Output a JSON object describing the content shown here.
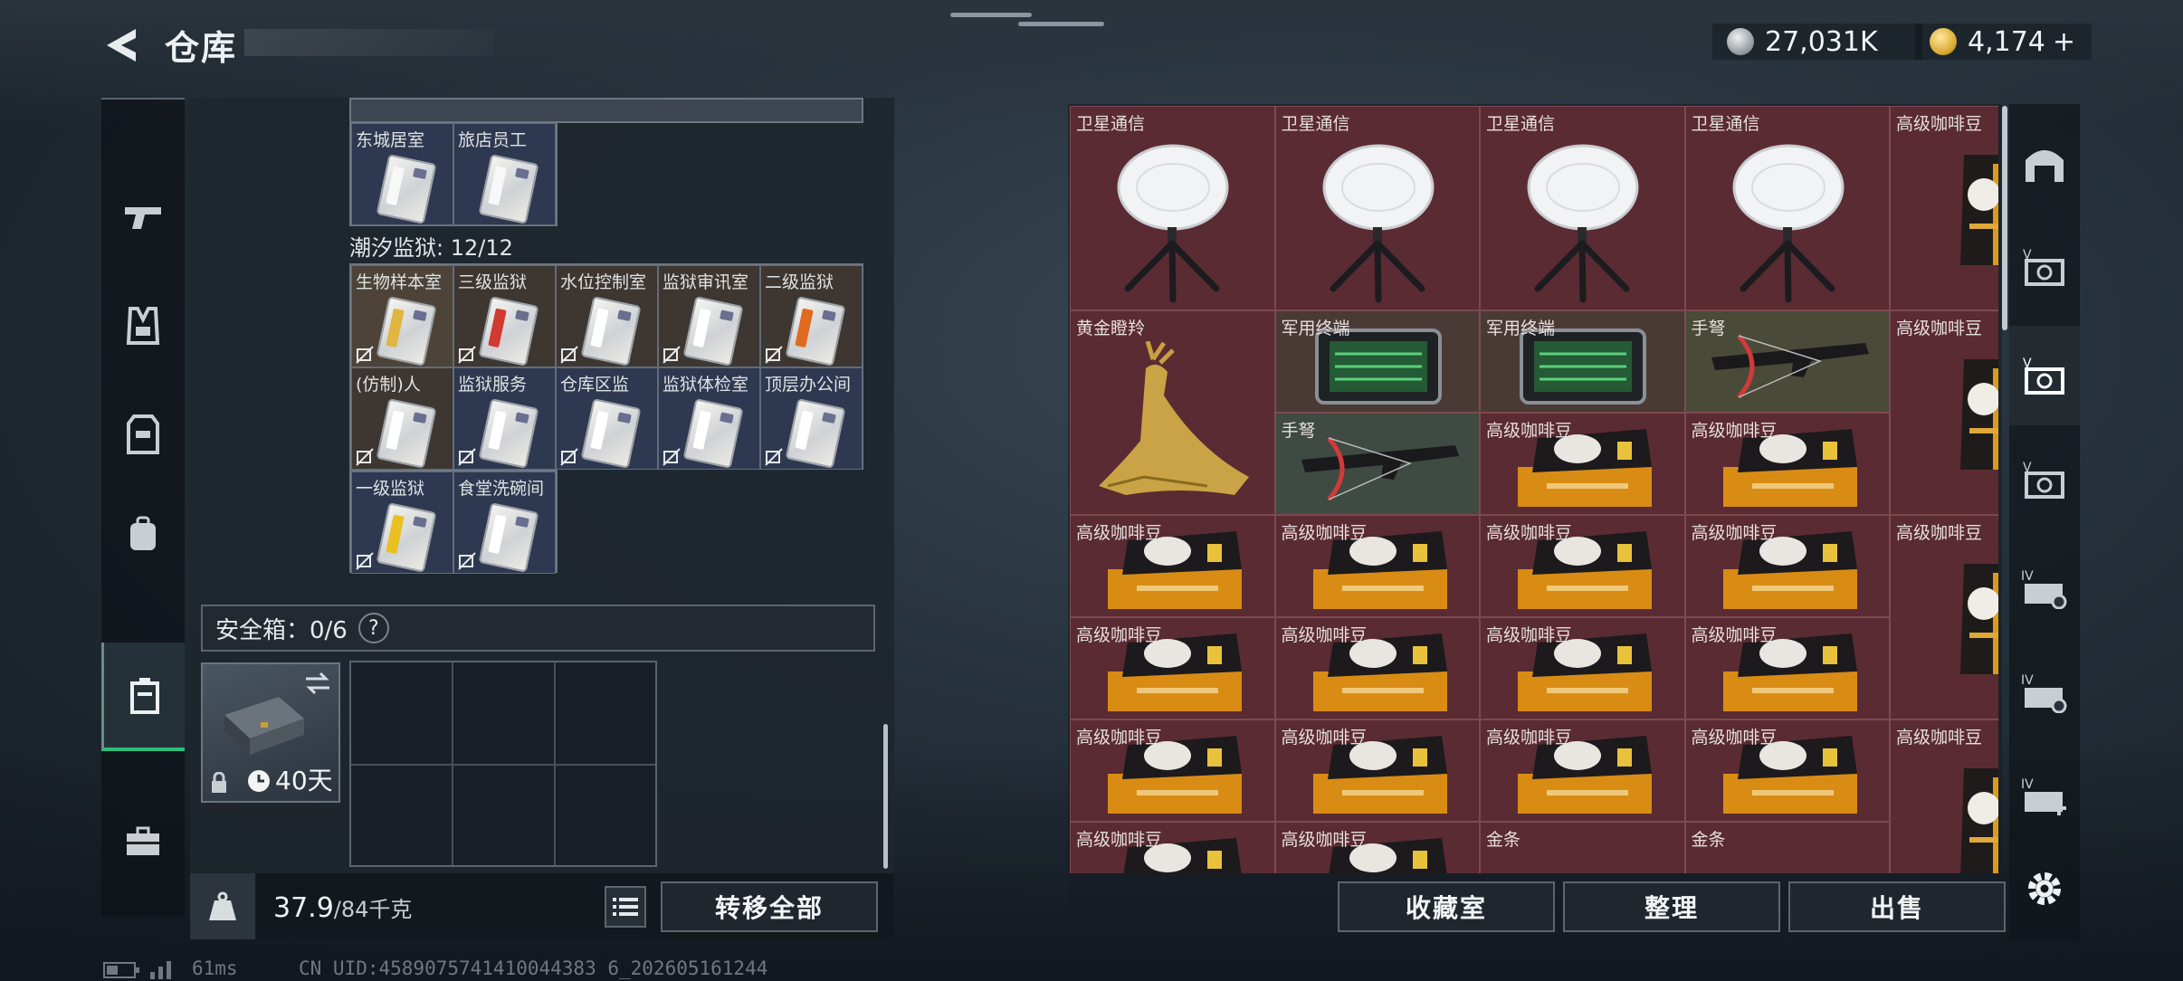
{
  "header": {
    "title": "仓库",
    "currency_silver": "27,031K",
    "currency_gold": "4,174",
    "currency_add": "+"
  },
  "colors": {
    "accent_green": "#27c07a",
    "item_red": "#5a2b32",
    "slot_gold": "#4e4338",
    "slot_blue": "#2e3850"
  },
  "left_nav": {
    "items": [
      {
        "icon": "pistol-icon"
      },
      {
        "icon": "vest-icon"
      },
      {
        "icon": "armor-icon"
      },
      {
        "icon": "backpack-icon"
      },
      {
        "icon": "safe-case-icon",
        "active": true
      },
      {
        "icon": "toolbox-icon"
      }
    ]
  },
  "left_panel": {
    "group_top": {
      "cells": [
        {
          "label": "东城居室",
          "stripe": "#ffffff"
        },
        {
          "label": "旅店员工",
          "stripe": "#ffffff"
        }
      ]
    },
    "prison": {
      "title": "潮汐监狱: 12/12",
      "cells": [
        {
          "label": "生物样本室",
          "stripe": "#e0b640",
          "bg": "gold"
        },
        {
          "label": "三级监狱",
          "stripe": "#d03a30",
          "bg": "dgold"
        },
        {
          "label": "水位控制室",
          "stripe": "#ffffff",
          "bg": "dgold"
        },
        {
          "label": "监狱审讯室",
          "stripe": "#ffffff",
          "bg": "dgold"
        },
        {
          "label": "二级监狱",
          "stripe": "#e06a20",
          "bg": "dgold"
        },
        {
          "label": "(仿制)人",
          "stripe": "#ffffff",
          "bg": "dgold"
        },
        {
          "label": "监狱服务",
          "stripe": "#ffffff",
          "bg": "blue"
        },
        {
          "label": "仓库区监",
          "stripe": "#ffffff",
          "bg": "blue"
        },
        {
          "label": "监狱体检室",
          "stripe": "#ffffff",
          "bg": "blue"
        },
        {
          "label": "顶层办公间",
          "stripe": "#ffffff",
          "bg": "blue"
        },
        {
          "label": "一级监狱",
          "stripe": "#e8c020",
          "bg": "blue"
        },
        {
          "label": "食堂洗碗间",
          "stripe": "#ffffff",
          "bg": "blue"
        }
      ]
    },
    "safe_box": {
      "label": "安全箱：0/6",
      "help": "?",
      "duration": "40天"
    },
    "weight": {
      "current": "37.9",
      "max": "/84千克"
    },
    "transfer_all": "转移全部"
  },
  "right_panel": {
    "items": [
      {
        "label": "卫星通信",
        "art": "dish",
        "col": 0,
        "row": 0,
        "w": 1,
        "h": 2
      },
      {
        "label": "卫星通信",
        "art": "dish",
        "col": 1,
        "row": 0,
        "w": 1,
        "h": 2
      },
      {
        "label": "卫星通信",
        "art": "dish",
        "col": 2,
        "row": 0,
        "w": 1,
        "h": 2
      },
      {
        "label": "卫星通信",
        "art": "dish",
        "col": 3,
        "row": 0,
        "w": 1,
        "h": 2
      },
      {
        "label": "高级咖啡豆",
        "art": "coffee_bag",
        "col": 4,
        "row": 0,
        "w": 1,
        "h": 2
      },
      {
        "label": "黄金瞪羚",
        "art": "gazelle",
        "col": 0,
        "row": 2,
        "w": 1,
        "h": 2
      },
      {
        "label": "军用终端",
        "art": "terminal",
        "col": 1,
        "row": 2,
        "w": 1,
        "h": 1
      },
      {
        "label": "军用终端",
        "art": "terminal",
        "col": 2,
        "row": 2,
        "w": 1,
        "h": 1
      },
      {
        "label": "手弩",
        "art": "crossbow",
        "col": 3,
        "row": 2,
        "w": 1,
        "h": 1
      },
      {
        "label": "高级咖啡豆",
        "art": "coffee_bag",
        "col": 4,
        "row": 2,
        "w": 1,
        "h": 2
      },
      {
        "label": "手弩",
        "art": "crossbow",
        "col": 1,
        "row": 3,
        "w": 1,
        "h": 1
      },
      {
        "label": "高级咖啡豆",
        "art": "coffee_box",
        "col": 2,
        "row": 3,
        "w": 1,
        "h": 1
      },
      {
        "label": "高级咖啡豆",
        "art": "coffee_box",
        "col": 3,
        "row": 3,
        "w": 1,
        "h": 1
      },
      {
        "label": "高级咖啡豆",
        "art": "coffee_box",
        "col": 0,
        "row": 4,
        "w": 1,
        "h": 1
      },
      {
        "label": "高级咖啡豆",
        "art": "coffee_box",
        "col": 1,
        "row": 4,
        "w": 1,
        "h": 1
      },
      {
        "label": "高级咖啡豆",
        "art": "coffee_box",
        "col": 2,
        "row": 4,
        "w": 1,
        "h": 1
      },
      {
        "label": "高级咖啡豆",
        "art": "coffee_box",
        "col": 3,
        "row": 4,
        "w": 1,
        "h": 1
      },
      {
        "label": "高级咖啡豆",
        "art": "coffee_bag",
        "col": 4,
        "row": 4,
        "w": 1,
        "h": 2
      },
      {
        "label": "高级咖啡豆",
        "art": "coffee_box",
        "col": 0,
        "row": 5,
        "w": 1,
        "h": 1
      },
      {
        "label": "高级咖啡豆",
        "art": "coffee_box",
        "col": 1,
        "row": 5,
        "w": 1,
        "h": 1
      },
      {
        "label": "高级咖啡豆",
        "art": "coffee_box",
        "col": 2,
        "row": 5,
        "w": 1,
        "h": 1
      },
      {
        "label": "高级咖啡豆",
        "art": "coffee_box",
        "col": 3,
        "row": 5,
        "w": 1,
        "h": 1
      },
      {
        "label": "高级咖啡豆",
        "art": "coffee_box",
        "col": 0,
        "row": 6,
        "w": 1,
        "h": 1
      },
      {
        "label": "高级咖啡豆",
        "art": "coffee_box",
        "col": 1,
        "row": 6,
        "w": 1,
        "h": 1
      },
      {
        "label": "高级咖啡豆",
        "art": "coffee_box",
        "col": 2,
        "row": 6,
        "w": 1,
        "h": 1
      },
      {
        "label": "高级咖啡豆",
        "art": "coffee_box",
        "col": 3,
        "row": 6,
        "w": 1,
        "h": 1
      },
      {
        "label": "高级咖啡豆",
        "art": "coffee_bag",
        "col": 4,
        "row": 6,
        "w": 1,
        "h": 2
      },
      {
        "label": "高级咖啡豆",
        "art": "coffee_box",
        "col": 0,
        "row": 7,
        "w": 1,
        "h": 1
      },
      {
        "label": "高级咖啡豆",
        "art": "coffee_box",
        "col": 1,
        "row": 7,
        "w": 1,
        "h": 1
      },
      {
        "label": "金条",
        "art": "gold_bar",
        "col": 2,
        "row": 7,
        "w": 1,
        "h": 1
      },
      {
        "label": "金条",
        "art": "gold_bar",
        "col": 3,
        "row": 7,
        "w": 1,
        "h": 1
      }
    ],
    "buttons": {
      "collection": "收藏室",
      "sort": "整理",
      "sell": "出售"
    }
  },
  "right_nav": {
    "items": [
      {
        "icon": "stash-home-icon"
      },
      {
        "icon": "storage-v-icon"
      },
      {
        "icon": "storage-v-active-icon",
        "active": true
      },
      {
        "icon": "storage-v2-icon"
      },
      {
        "icon": "storage-iv-icon"
      },
      {
        "icon": "storage-iv2-icon"
      },
      {
        "icon": "storage-iv-add-icon"
      }
    ]
  },
  "status_bar": {
    "ping": "61ms",
    "uid": "CN UID:4589075741410044383 6_202605161244"
  }
}
